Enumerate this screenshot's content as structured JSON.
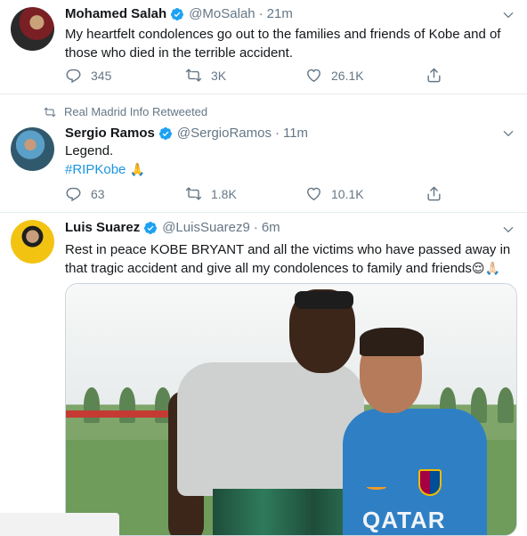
{
  "tweets": [
    {
      "name": "Mohamed Salah",
      "handle": "@MoSalah",
      "separator": "·",
      "time": "21m",
      "text": "My heartfelt condolences go out to the families and friends of Kobe and of those who died in the terrible accident.",
      "replies": "345",
      "retweets": "3K",
      "likes": "26.1K"
    },
    {
      "retweeted_by": "Real Madrid Info Retweeted",
      "name": "Sergio Ramos",
      "handle": "@SergioRamos",
      "separator": "·",
      "time": "11m",
      "text_line1": "Legend.",
      "hashtag": "#RIPKobe",
      "emoji": "🙏",
      "replies": "63",
      "retweets": "1.8K",
      "likes": "10.1K"
    },
    {
      "name": "Luis Suarez",
      "handle": "@LuisSuarez9",
      "separator": "·",
      "time": "6m",
      "text": "Rest in peace KOBE BRYANT and all the victims who have passed away in that tragic accident and give all my condolences to family and friends",
      "emoji": "😌🙏🏻",
      "media_jersey_text": "QATAR"
    }
  ],
  "colors": {
    "accent": "#1da1f2",
    "secondary_text": "#657786",
    "primary_text": "#14171a",
    "divider": "#e6ecf0"
  },
  "icons": [
    "verified-badge-icon",
    "chevron-down-icon",
    "reply-icon",
    "retweet-icon",
    "like-icon",
    "share-icon"
  ]
}
